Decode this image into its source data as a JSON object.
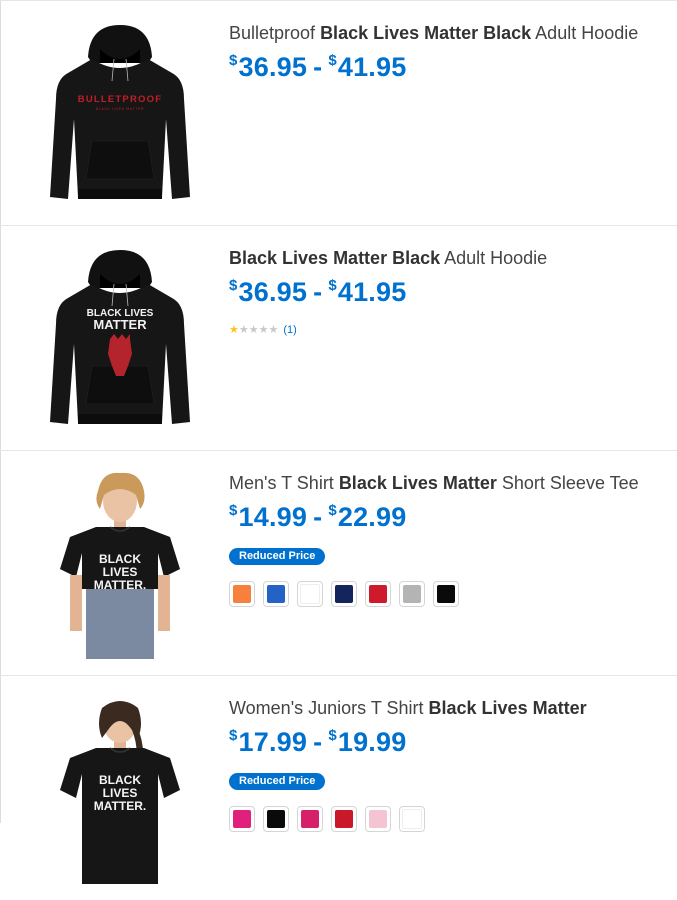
{
  "products": [
    {
      "title_parts": [
        [
          "Bulletproof ",
          false
        ],
        [
          "Black Lives Matter Black",
          true
        ],
        [
          " Adult Hoodie",
          false
        ]
      ],
      "price_low": "36.95",
      "price_high": "41.95",
      "currency": "$",
      "image": "bulletproof-hoodie-icon",
      "print_text": "BULLETPROOF",
      "print_sub": "BLACK LIVES MATTER"
    },
    {
      "title_parts": [
        [
          "Black Lives Matter Black",
          true
        ],
        [
          " Adult Hoodie",
          false
        ]
      ],
      "price_low": "36.95",
      "price_high": "41.95",
      "currency": "$",
      "image": "fist-hoodie-icon",
      "print_text": "BLACK LIVES\nMATTER",
      "rating": 1,
      "rating_max": 5,
      "review_count": "(1)"
    },
    {
      "title_parts": [
        [
          "Men's T Shirt ",
          false
        ],
        [
          "Black Lives Matter",
          true
        ],
        [
          " Short Sleeve Tee",
          false
        ]
      ],
      "price_low": "14.99",
      "price_high": "22.99",
      "currency": "$",
      "image": "mens-tee-icon",
      "print_text": "BLACK\nLIVES\nMATTER.",
      "badge": "Reduced Price",
      "swatch_colors": [
        "#f7813c",
        "#2462c6",
        "#ffffff",
        "#13255a",
        "#cf1a2b",
        "#b4b4b4",
        "#0a0a0a"
      ]
    },
    {
      "title_parts": [
        [
          "Women's Juniors T Shirt ",
          false
        ],
        [
          "Black Lives Matter",
          true
        ]
      ],
      "price_low": "17.99",
      "price_high": "19.99",
      "currency": "$",
      "image": "womens-tee-icon",
      "print_text": "BLACK\nLIVES\nMATTER.",
      "badge": "Reduced Price",
      "swatch_colors": [
        "#e0207a",
        "#0a0a0a",
        "#d6206a",
        "#c9182a",
        "#f5c4d2",
        "#ffffff"
      ]
    }
  ]
}
